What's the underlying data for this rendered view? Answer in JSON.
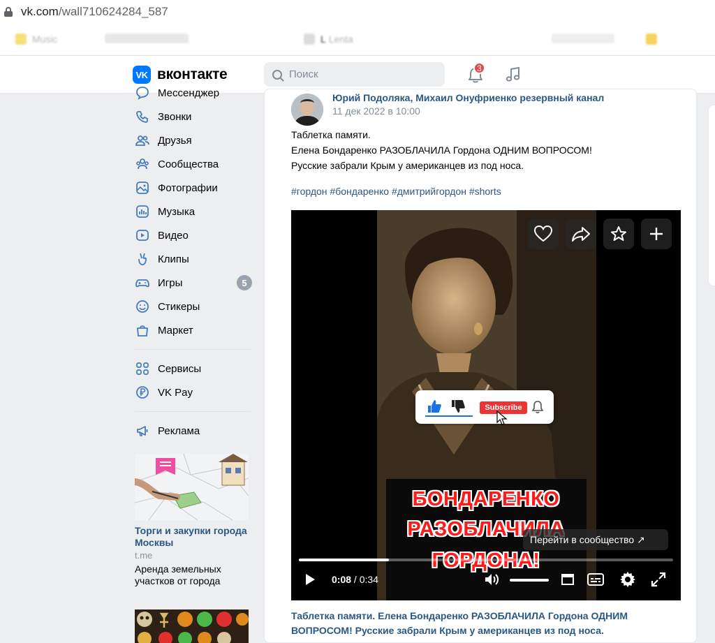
{
  "browser": {
    "url_main": "vk.com",
    "url_path": "/wall710624284_587",
    "bookmarks": [
      "Music",
      "Music",
      "L",
      "Lenta"
    ]
  },
  "header": {
    "logo_badge": "VK",
    "logo_text": "вконтакте",
    "search_placeholder": "Поиск",
    "notifications_count": "3"
  },
  "left_menu": {
    "items": [
      {
        "label": "Мессенджер",
        "icon": "messenger-icon"
      },
      {
        "label": "Звонки",
        "icon": "phone-icon"
      },
      {
        "label": "Друзья",
        "icon": "friends-icon"
      },
      {
        "label": "Сообщества",
        "icon": "communities-icon"
      },
      {
        "label": "Фотографии",
        "icon": "photos-icon"
      },
      {
        "label": "Музыка",
        "icon": "music-icon"
      },
      {
        "label": "Видео",
        "icon": "video-icon"
      },
      {
        "label": "Клипы",
        "icon": "clips-icon"
      },
      {
        "label": "Игры",
        "icon": "games-icon",
        "badge": "5"
      },
      {
        "label": "Стикеры",
        "icon": "stickers-icon"
      },
      {
        "label": "Маркет",
        "icon": "market-icon"
      }
    ],
    "services": [
      {
        "label": "Сервисы",
        "icon": "services-icon"
      },
      {
        "label": "VK Pay",
        "icon": "vkpay-icon"
      }
    ],
    "ads_label": "Реклама"
  },
  "ad": {
    "title": "Торги и закупки города Москвы",
    "domain": "t.me",
    "description": "Аренда земельных участков от города"
  },
  "post": {
    "author": "Юрий Подоляка, Михаил Онуфриенко резервный канал",
    "date": "11 дек 2022 в 10:00",
    "text_lines": [
      "Таблетка памяти.",
      "Елена Бондаренко РАЗОБЛАЧИЛА Гордона ОДНИМ ВОПРОСОМ!",
      "Русские забрали Крым у американцев из под носа."
    ],
    "hashtags": "#гордон #бондаренко #дмитрийгордон #shorts",
    "caption": "Таблетка памяти. Елена Бондаренко РАЗОБЛАЧИЛА Гордона ОДНИМ ВОПРОСОМ! Русские забрали Крым у американцев из под носа."
  },
  "video": {
    "banner_lines": [
      "БОНДАРЕНКО",
      "РАЗОБЛАЧИЛА",
      "ГОРДОНА!"
    ],
    "subscribe_label": "Subscribe",
    "goto_community": "Перейти в сообщество ↗",
    "time_current": "0:08",
    "time_separator": " / ",
    "time_total": "0:34",
    "progress_fraction": 0.24
  },
  "colors": {
    "vk_blue": "#0077ff",
    "link": "#2a5885",
    "badge_red": "#e64646"
  }
}
